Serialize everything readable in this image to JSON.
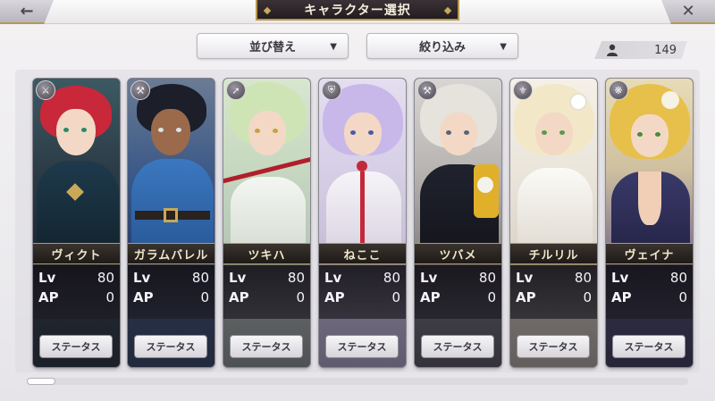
{
  "header": {
    "title": "キャラクター選択",
    "back_icon": "arrow-left-icon",
    "close_icon": "close-icon"
  },
  "toolbar": {
    "sort_label": "並び替え",
    "filter_label": "絞り込み",
    "character_count": "149"
  },
  "characters": [
    {
      "name": "ヴィクト",
      "lv": "80",
      "ap": "0",
      "status_label": "ステータス",
      "class_icon": "sword-icon"
    },
    {
      "name": "ガラムバレル",
      "lv": "80",
      "ap": "0",
      "status_label": "ステータス",
      "class_icon": "axe-icon"
    },
    {
      "name": "ツキハ",
      "lv": "80",
      "ap": "0",
      "status_label": "ステータス",
      "class_icon": "spear-icon"
    },
    {
      "name": "ねここ",
      "lv": "80",
      "ap": "0",
      "status_label": "ステータス",
      "class_icon": "shield-icon"
    },
    {
      "name": "ツバメ",
      "lv": "80",
      "ap": "0",
      "status_label": "ステータス",
      "class_icon": "hammer-icon"
    },
    {
      "name": "チルリル",
      "lv": "80",
      "ap": "0",
      "status_label": "ステータス",
      "class_icon": "staff-icon"
    },
    {
      "name": "ヴェイナ",
      "lv": "80",
      "ap": "0",
      "status_label": "ステータス",
      "class_icon": "orb-icon"
    }
  ],
  "labels": {
    "lv": "Lv",
    "ap": "AP"
  },
  "colors": {
    "accent_gold": "#b99b58",
    "card_dark": "#2c2a33"
  }
}
